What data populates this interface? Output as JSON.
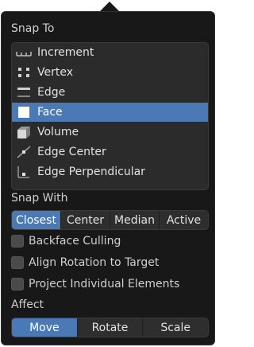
{
  "snap_to": {
    "title": "Snap To",
    "items": [
      {
        "label": "Increment",
        "icon": "increment-icon",
        "active": false
      },
      {
        "label": "Vertex",
        "icon": "vertex-icon",
        "active": false
      },
      {
        "label": "Edge",
        "icon": "edge-icon",
        "active": false
      },
      {
        "label": "Face",
        "icon": "face-icon",
        "active": true
      },
      {
        "label": "Volume",
        "icon": "volume-icon",
        "active": false
      },
      {
        "label": "Edge Center",
        "icon": "edge-center-icon",
        "active": false
      },
      {
        "label": "Edge Perpendicular",
        "icon": "edge-perpendicular-icon",
        "active": false
      }
    ]
  },
  "snap_with": {
    "title": "Snap With",
    "options": [
      "Closest",
      "Center",
      "Median",
      "Active"
    ],
    "selected": "Closest"
  },
  "options": {
    "backface_culling": {
      "label": "Backface Culling",
      "checked": false
    },
    "align_rotation": {
      "label": "Align Rotation to Target",
      "checked": false
    },
    "project_individual": {
      "label": "Project Individual Elements",
      "checked": false
    }
  },
  "affect": {
    "title": "Affect",
    "options": [
      "Move",
      "Rotate",
      "Scale"
    ],
    "selected": "Move"
  },
  "colors": {
    "panel_bg": "#181818",
    "accent": "#4a79b6",
    "list_bg": "#2b2b2b"
  }
}
